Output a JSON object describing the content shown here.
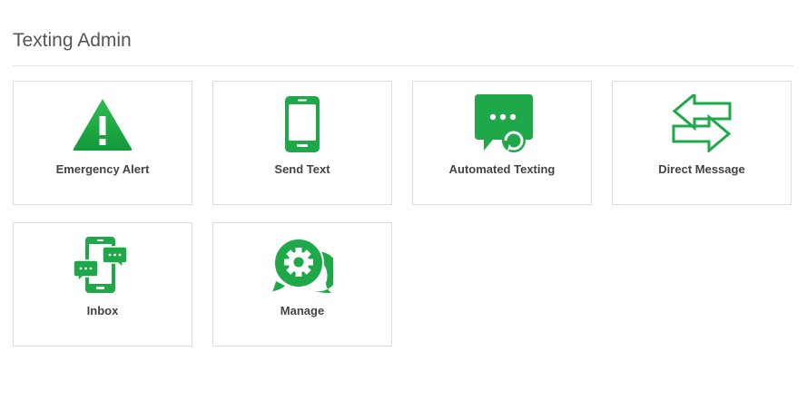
{
  "page": {
    "title": "Texting Admin"
  },
  "accent_color": "#1ea84a",
  "tiles": [
    {
      "label": "Emergency Alert",
      "icon": "warning-triangle-icon"
    },
    {
      "label": "Send Text",
      "icon": "mobile-phone-icon"
    },
    {
      "label": "Automated Texting",
      "icon": "chat-bubble-refresh-icon"
    },
    {
      "label": "Direct Message",
      "icon": "swap-arrows-icon"
    },
    {
      "label": "Inbox",
      "icon": "phone-chat-bubbles-icon"
    },
    {
      "label": "Manage",
      "icon": "gear-chat-icon"
    }
  ]
}
